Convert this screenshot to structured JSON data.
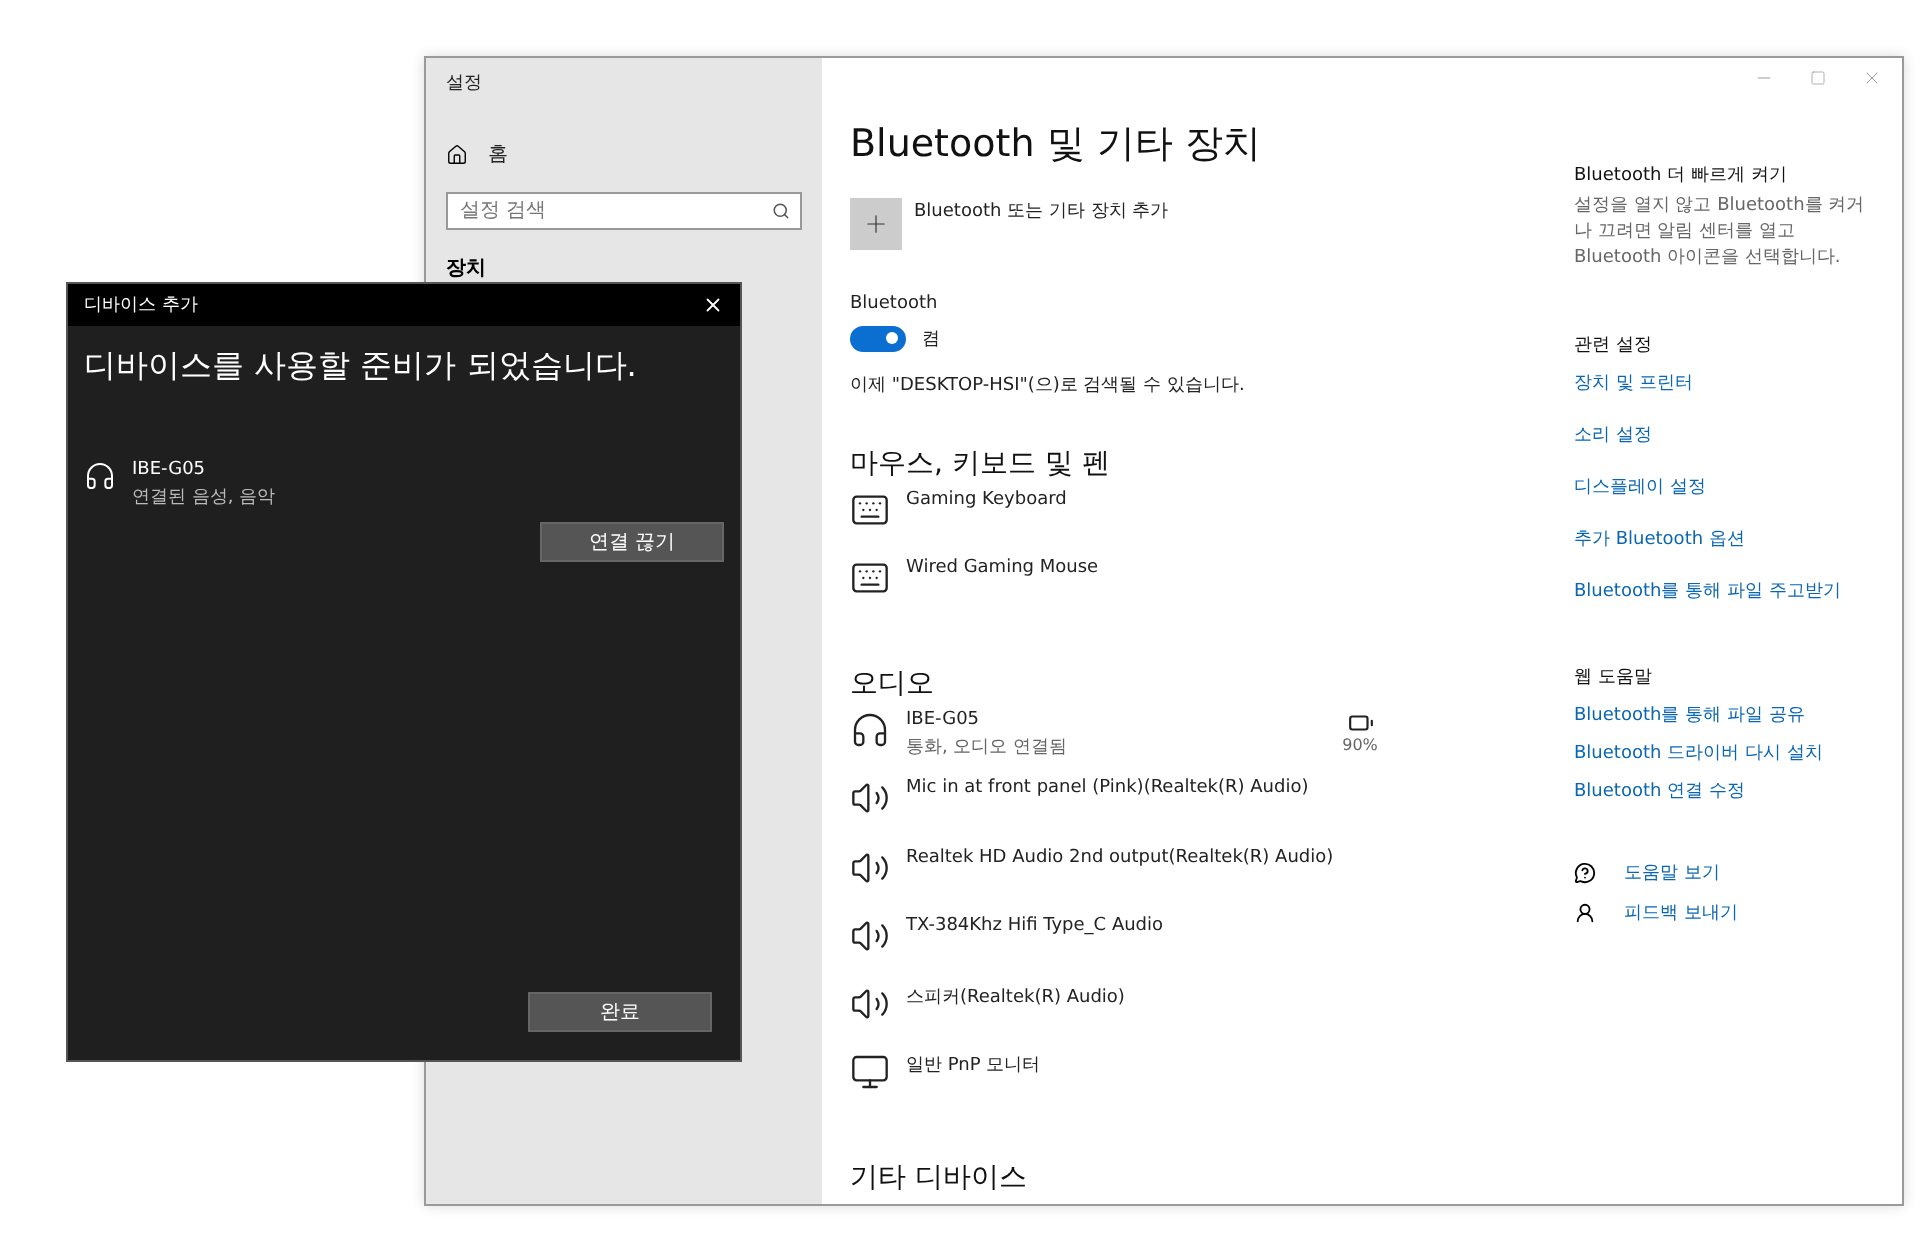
{
  "settings_window": {
    "title": "설정",
    "sidebar": {
      "home": "홈",
      "search": {
        "placeholder": "설정 검색"
      },
      "section": "장치"
    },
    "main": {
      "heading": "Bluetooth 및 기타 장치",
      "add_device": "Bluetooth 또는 기타 장치 추가",
      "bluetooth": {
        "label": "Bluetooth",
        "on": true,
        "state_text": "켬",
        "discoverable": "이제 \"DESKTOP-HSI\"(으)로 검색될 수 있습니다."
      },
      "sections": [
        {
          "title": "마우스, 키보드 및 펜",
          "devices": [
            {
              "kind": "keyboard",
              "name": "Gaming Keyboard"
            },
            {
              "kind": "keyboard",
              "name": "Wired Gaming Mouse"
            }
          ]
        },
        {
          "title": "오디오",
          "devices": [
            {
              "kind": "headset",
              "name": "IBE-G05",
              "status": "통화, 오디오 연결됨",
              "battery": "90%"
            },
            {
              "kind": "speaker",
              "name": "Mic in at front panel (Pink)(Realtek(R) Audio)"
            },
            {
              "kind": "speaker",
              "name": "Realtek HD Audio 2nd output(Realtek(R) Audio)"
            },
            {
              "kind": "speaker",
              "name": "TX-384Khz Hifi Type_C Audio"
            },
            {
              "kind": "speaker",
              "name": "스피커(Realtek(R) Audio)"
            },
            {
              "kind": "monitor",
              "name": "일반 PnP 모니터"
            }
          ]
        },
        {
          "title": "기타 디바이스"
        }
      ]
    },
    "aside": {
      "tip_title": "Bluetooth 더 빠르게 켜기",
      "tip_text": "설정을 열지 않고 Bluetooth를 켜거나 끄려면 알림 센터를 열고 Bluetooth 아이콘을 선택합니다.",
      "groups": [
        {
          "title": "관련 설정",
          "links": [
            "장치 및 프린터",
            "소리 설정",
            "디스플레이 설정",
            "추가 Bluetooth 옵션",
            "Bluetooth를 통해 파일 주고받기"
          ]
        },
        {
          "title": "웹 도움말",
          "links": [
            "Bluetooth를 통해 파일 공유",
            "Bluetooth 드라이버 다시 설치",
            "Bluetooth 연결 수정"
          ]
        }
      ],
      "actions": [
        {
          "kind": "help",
          "label": "도움말 보기"
        },
        {
          "kind": "feedback",
          "label": "피드백 보내기"
        }
      ]
    }
  },
  "dialog": {
    "title": "디바이스 추가",
    "message": "디바이스를 사용할 준비가 되었습니다.",
    "device": {
      "name": "IBE-G05",
      "status": "연결된 음성, 음악"
    },
    "disconnect": "연결 끊기",
    "done": "완료"
  }
}
